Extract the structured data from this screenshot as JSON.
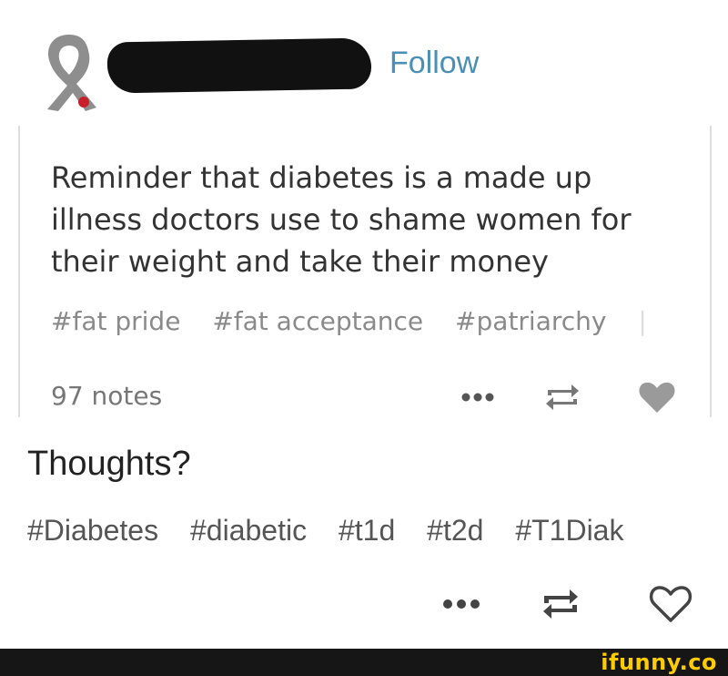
{
  "header": {
    "follow_label": "Follow"
  },
  "reblogged_post": {
    "text": "Reminder that diabetes is a made up illness doctors use to shame women for their weight and take their money",
    "tags": [
      "#fat pride",
      "#fat acceptance",
      "#patriarchy"
    ],
    "notes": "97 notes",
    "icons": [
      "more-icon",
      "reblog-icon",
      "heart-filled-icon"
    ]
  },
  "comment": {
    "text": "Thoughts?",
    "tags": [
      "#Diabetes",
      "#diabetic",
      "#t1d",
      "#t2d",
      "#T1Diak"
    ],
    "icons": [
      "more-icon",
      "reblog-icon",
      "heart-outline-icon"
    ]
  },
  "footer": {
    "watermark": "ifunny.co"
  },
  "colors": {
    "follow": "#4a8fb5",
    "ribbon": "#8e8e8e",
    "ribbon_accent": "#c8202a",
    "watermark": "#ffcc00",
    "footer_bg": "#161616"
  }
}
